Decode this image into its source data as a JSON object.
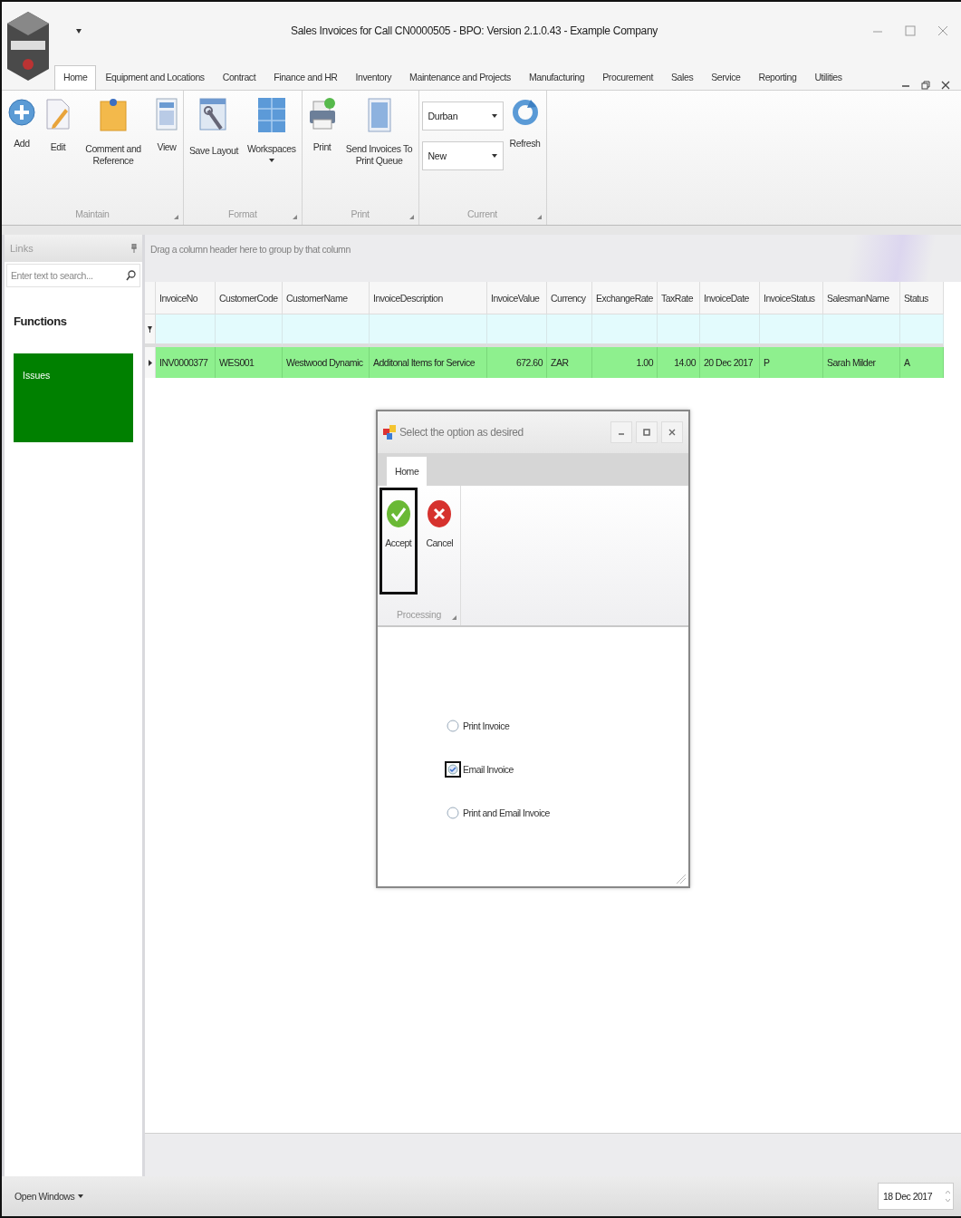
{
  "window": {
    "title": "Sales Invoices for Call CN0000505 - BPO: Version 2.1.0.43 - Example Company"
  },
  "ribbon_tabs": [
    {
      "label": "Home",
      "selected": true
    },
    {
      "label": "Equipment and Locations",
      "selected": false
    },
    {
      "label": "Contract",
      "selected": false
    },
    {
      "label": "Finance and HR",
      "selected": false
    },
    {
      "label": "Inventory",
      "selected": false
    },
    {
      "label": "Maintenance and Projects",
      "selected": false
    },
    {
      "label": "Manufacturing",
      "selected": false
    },
    {
      "label": "Procurement",
      "selected": false
    },
    {
      "label": "Sales",
      "selected": false
    },
    {
      "label": "Service",
      "selected": false
    },
    {
      "label": "Reporting",
      "selected": false
    },
    {
      "label": "Utilities",
      "selected": false
    }
  ],
  "ribbon_groups": [
    {
      "label": "Maintain",
      "items": [
        {
          "kind": "button",
          "label": "Add"
        },
        {
          "kind": "button",
          "label": "Edit"
        },
        {
          "kind": "button",
          "label": "Comment and Reference"
        },
        {
          "kind": "button",
          "label": "View"
        }
      ]
    },
    {
      "label": "Format",
      "items": [
        {
          "kind": "button",
          "label": "Save Layout"
        },
        {
          "kind": "menu",
          "label": "Workspaces"
        }
      ]
    },
    {
      "label": "Print",
      "items": [
        {
          "kind": "button",
          "label": "Print"
        },
        {
          "kind": "button",
          "label": "Send Invoices To Print Queue"
        }
      ]
    },
    {
      "label": "Current",
      "items": [
        {
          "kind": "combos",
          "values": [
            "Durban",
            "New"
          ]
        },
        {
          "kind": "button",
          "label": "Refresh"
        }
      ]
    }
  ],
  "sidebar": {
    "title": "Links",
    "search": {
      "placeholder": "Enter text to search..."
    },
    "heading": "Functions",
    "tiles": [
      {
        "label": "Issues"
      }
    ]
  },
  "grid": {
    "group_panel_hint": "Drag a column header here to group by that column",
    "columns": [
      {
        "label": "InvoiceNo",
        "kind": "text"
      },
      {
        "label": "CustomerCode",
        "kind": "text"
      },
      {
        "label": "CustomerName",
        "kind": "text"
      },
      {
        "label": "InvoiceDescription",
        "kind": "text"
      },
      {
        "label": "InvoiceValue",
        "kind": "number"
      },
      {
        "label": "Currency",
        "kind": "text"
      },
      {
        "label": "ExchangeRate",
        "kind": "number"
      },
      {
        "label": "TaxRate",
        "kind": "number"
      },
      {
        "label": "InvoiceDate",
        "kind": "text"
      },
      {
        "label": "InvoiceStatus",
        "kind": "text"
      },
      {
        "label": "SalesmanName",
        "kind": "text"
      },
      {
        "label": "Status",
        "kind": "text"
      }
    ],
    "rows": [
      {
        "selected": true,
        "cells": [
          "INV0000377",
          "WES001",
          "Westwood Dynamic",
          "Additonal Items for Service",
          "672.60",
          "ZAR",
          "1.00",
          "14.00",
          "20 Dec 2017",
          "P",
          "Sarah Milder",
          "A"
        ]
      }
    ]
  },
  "dialog": {
    "title": "Select the option as desired",
    "tabs": [
      {
        "label": "Home",
        "selected": true
      }
    ],
    "group": "Processing",
    "buttons": [
      {
        "label": "Accept",
        "focused": true
      },
      {
        "label": "Cancel",
        "focused": false
      }
    ],
    "options": [
      {
        "label": "Print Invoice",
        "selected": false
      },
      {
        "label": "Email Invoice",
        "selected": true
      },
      {
        "label": "Print and Email Invoice",
        "selected": false
      }
    ]
  },
  "status_bar": {
    "open_windows": "Open Windows",
    "date": "18 Dec 2017"
  }
}
